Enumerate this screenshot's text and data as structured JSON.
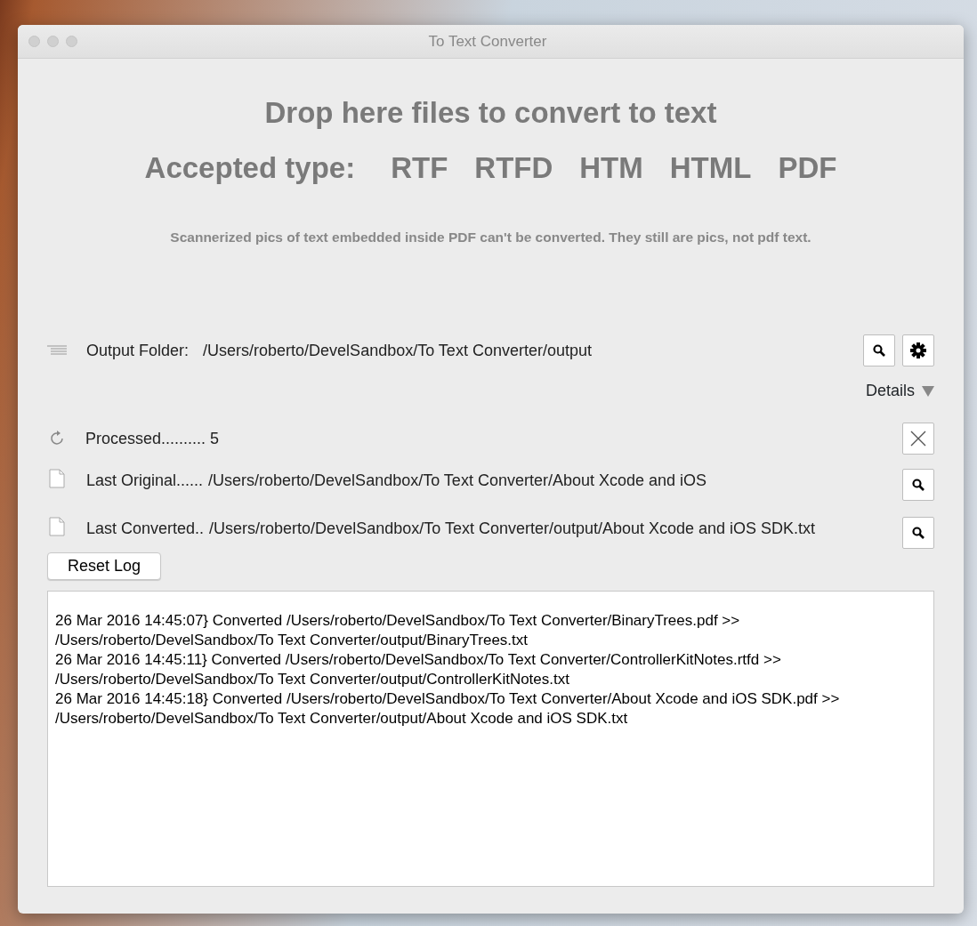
{
  "window": {
    "title": "To Text Converter"
  },
  "drop_title": "Drop here files to convert to text",
  "accepted": {
    "label": "Accepted type:",
    "types": [
      "RTF",
      "RTFD",
      "HTM",
      "HTML",
      "PDF"
    ]
  },
  "note": "Scannerized pics of text embedded inside PDF can't be converted. They still are pics, not pdf text.",
  "output_folder": {
    "label": "Output Folder:",
    "path": "/Users/roberto/DevelSandbox/To Text Converter/output"
  },
  "details": {
    "label": "Details",
    "expanded": true
  },
  "status_rows": [
    {
      "kind": "processed",
      "label": "Processed.......... 5"
    },
    {
      "kind": "file",
      "label": "Last Original......",
      "value": "/Users/roberto/DevelSandbox/To Text Converter/About Xcode and iOS"
    },
    {
      "kind": "file",
      "label": "Last Converted..",
      "value": "/Users/roberto/DevelSandbox/To Text Converter/output/About Xcode and iOS SDK.txt"
    }
  ],
  "reset_button": "Reset Log",
  "log": [
    "26 Mar 2016 14:45:07} Converted /Users/roberto/DevelSandbox/To Text Converter/BinaryTrees.pdf  >>  /Users/roberto/DevelSandbox/To Text Converter/output/BinaryTrees.txt",
    "26 Mar 2016 14:45:11} Converted /Users/roberto/DevelSandbox/To Text Converter/ControllerKitNotes.rtfd  >>  /Users/roberto/DevelSandbox/To Text Converter/output/ControllerKitNotes.txt",
    "26 Mar 2016 14:45:18} Converted /Users/roberto/DevelSandbox/To Text Converter/About Xcode and iOS SDK.pdf  >>  /Users/roberto/DevelSandbox/To Text Converter/output/About Xcode and iOS SDK.txt"
  ]
}
